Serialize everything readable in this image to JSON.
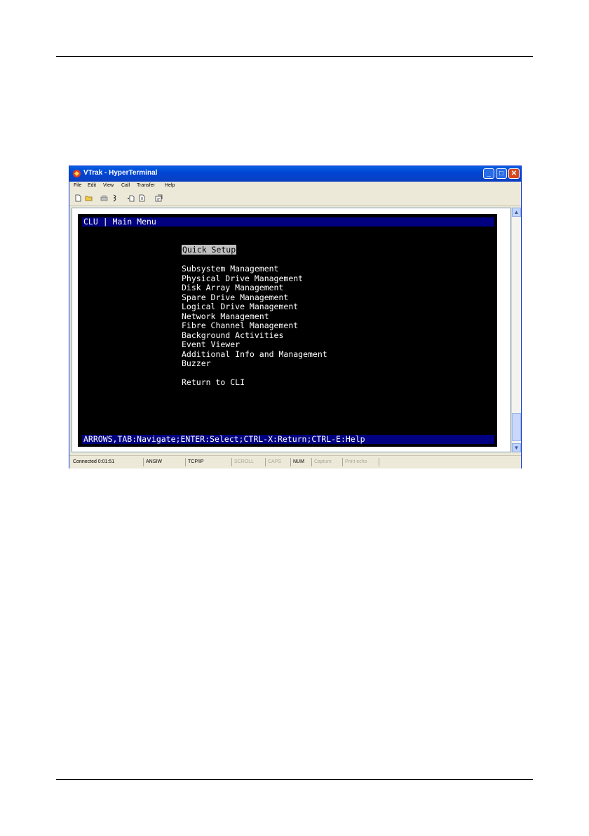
{
  "window": {
    "title": "VTrak - HyperTerminal",
    "buttons": {
      "minimize": "_",
      "maximize": "□",
      "close": "✕"
    }
  },
  "menubar": [
    "File",
    "Edit",
    "View",
    "Call",
    "Transfer",
    "Help"
  ],
  "toolbar": [
    "new-icon",
    "open-icon",
    "disconnect-icon",
    "dial-icon",
    "send-icon",
    "receive-icon",
    "properties-icon"
  ],
  "terminal": {
    "header": "CLU | Main Menu",
    "menu": [
      "Quick Setup",
      "Subsystem Management",
      "Physical Drive Management",
      "Disk Array Management",
      "Spare Drive Management",
      "Logical Drive Management",
      "Network Management",
      "Fibre Channel Management",
      "Background Activities",
      "Event Viewer",
      "Additional Info and Management",
      "Buzzer",
      "Return to CLI"
    ],
    "selected": "Quick Setup",
    "footer": "ARROWS,TAB:Navigate;ENTER:Select;CTRL-X:Return;CTRL-E:Help"
  },
  "statusbar": {
    "connected": "Connected 0:01:51",
    "emulation": "ANSIW",
    "protocol": "TCP/IP",
    "scroll": "SCROLL",
    "caps": "CAPS",
    "num": "NUM",
    "capture": "Capture",
    "print_echo": "Print echo"
  },
  "colors": {
    "terminal_bg": "#000000",
    "terminal_bar": "#000080",
    "titlebar": "#0046d5",
    "selection": "#c0c0c0"
  }
}
